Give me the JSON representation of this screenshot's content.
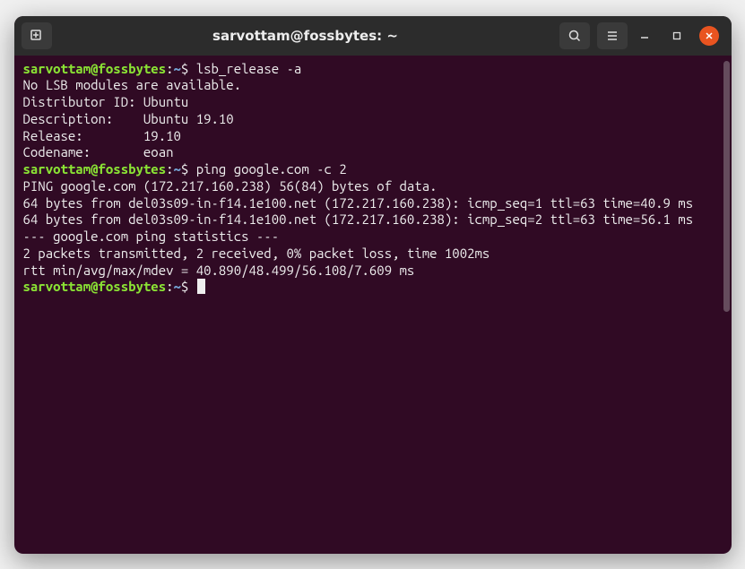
{
  "titlebar": {
    "title": "sarvottam@fossbytes: ~"
  },
  "prompt": {
    "user_host": "sarvottam@fossbytes",
    "sep": ":",
    "path": "~",
    "dollar": "$"
  },
  "commands": {
    "cmd1": " lsb_release -a",
    "cmd2": " ping google.com -c 2",
    "cmd3": " "
  },
  "output": {
    "lsb1": "No LSB modules are available.",
    "lsb2": "Distributor ID: Ubuntu",
    "lsb3": "Description:    Ubuntu 19.10",
    "lsb4": "Release:        19.10",
    "lsb5": "Codename:       eoan",
    "ping1": "PING google.com (172.217.160.238) 56(84) bytes of data.",
    "ping2": "64 bytes from del03s09-in-f14.1e100.net (172.217.160.238): icmp_seq=1 ttl=63 time=40.9 ms",
    "ping3": "64 bytes from del03s09-in-f14.1e100.net (172.217.160.238): icmp_seq=2 ttl=63 time=56.1 ms",
    "ping4": "",
    "ping5": "--- google.com ping statistics ---",
    "ping6": "2 packets transmitted, 2 received, 0% packet loss, time 1002ms",
    "ping7": "rtt min/avg/max/mdev = 40.890/48.499/56.108/7.609 ms"
  }
}
